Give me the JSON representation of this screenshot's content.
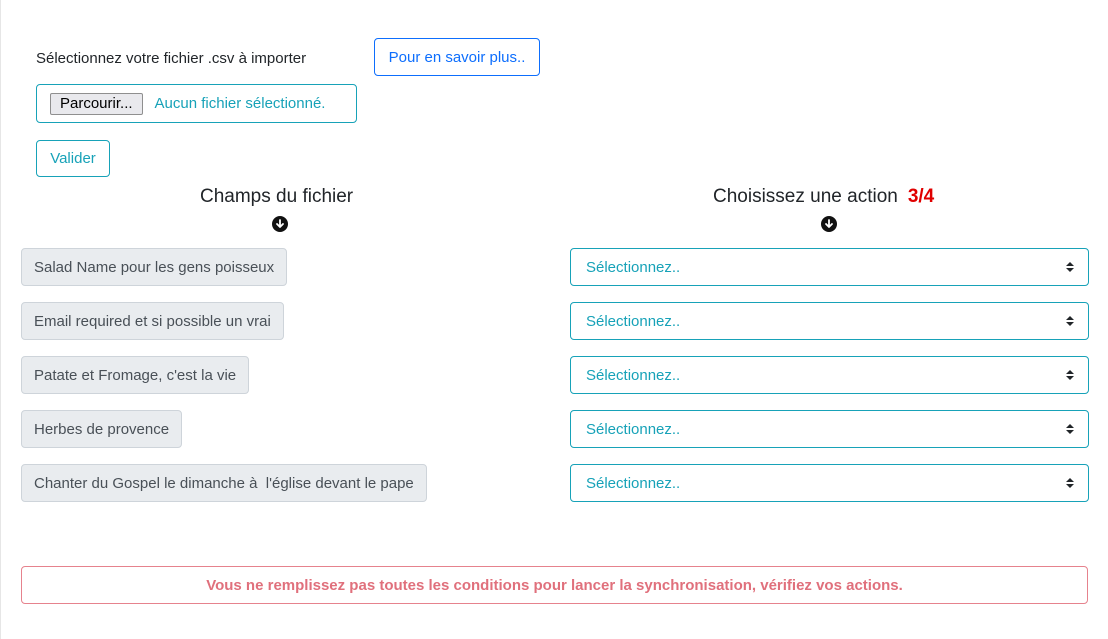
{
  "upload": {
    "label": "Sélectionnez votre fichier .csv à importer",
    "more_button": "Pour en savoir plus..",
    "browse_button": "Parcourir...",
    "no_file_text": "Aucun fichier sélectionné.",
    "validate_button": "Valider"
  },
  "columns": {
    "left_title": "Champs du fichier",
    "right_title": "Choisissez une action",
    "progress": "3/4",
    "arrow_icon": "arrow-circle-down-icon"
  },
  "rows": [
    {
      "field": "Salad Name pour les gens poisseux",
      "action": "Sélectionnez.."
    },
    {
      "field": "Email required et si possible un vrai",
      "action": "Sélectionnez.."
    },
    {
      "field": "Patate et Fromage, c'est la vie",
      "action": "Sélectionnez.."
    },
    {
      "field": "Herbes de provence",
      "action": "Sélectionnez.."
    },
    {
      "field": "Chanter du Gospel le dimanche à  l'église devant le pape",
      "action": "Sélectionnez.."
    }
  ],
  "alert": {
    "message": "Vous ne remplissez pas toutes les conditions pour lancer la synchronisation, vérifiez vos actions."
  },
  "colors": {
    "info": "#17a2b8",
    "primary": "#0d6efd",
    "danger": "#e00000",
    "alert_text": "#e0707c"
  }
}
